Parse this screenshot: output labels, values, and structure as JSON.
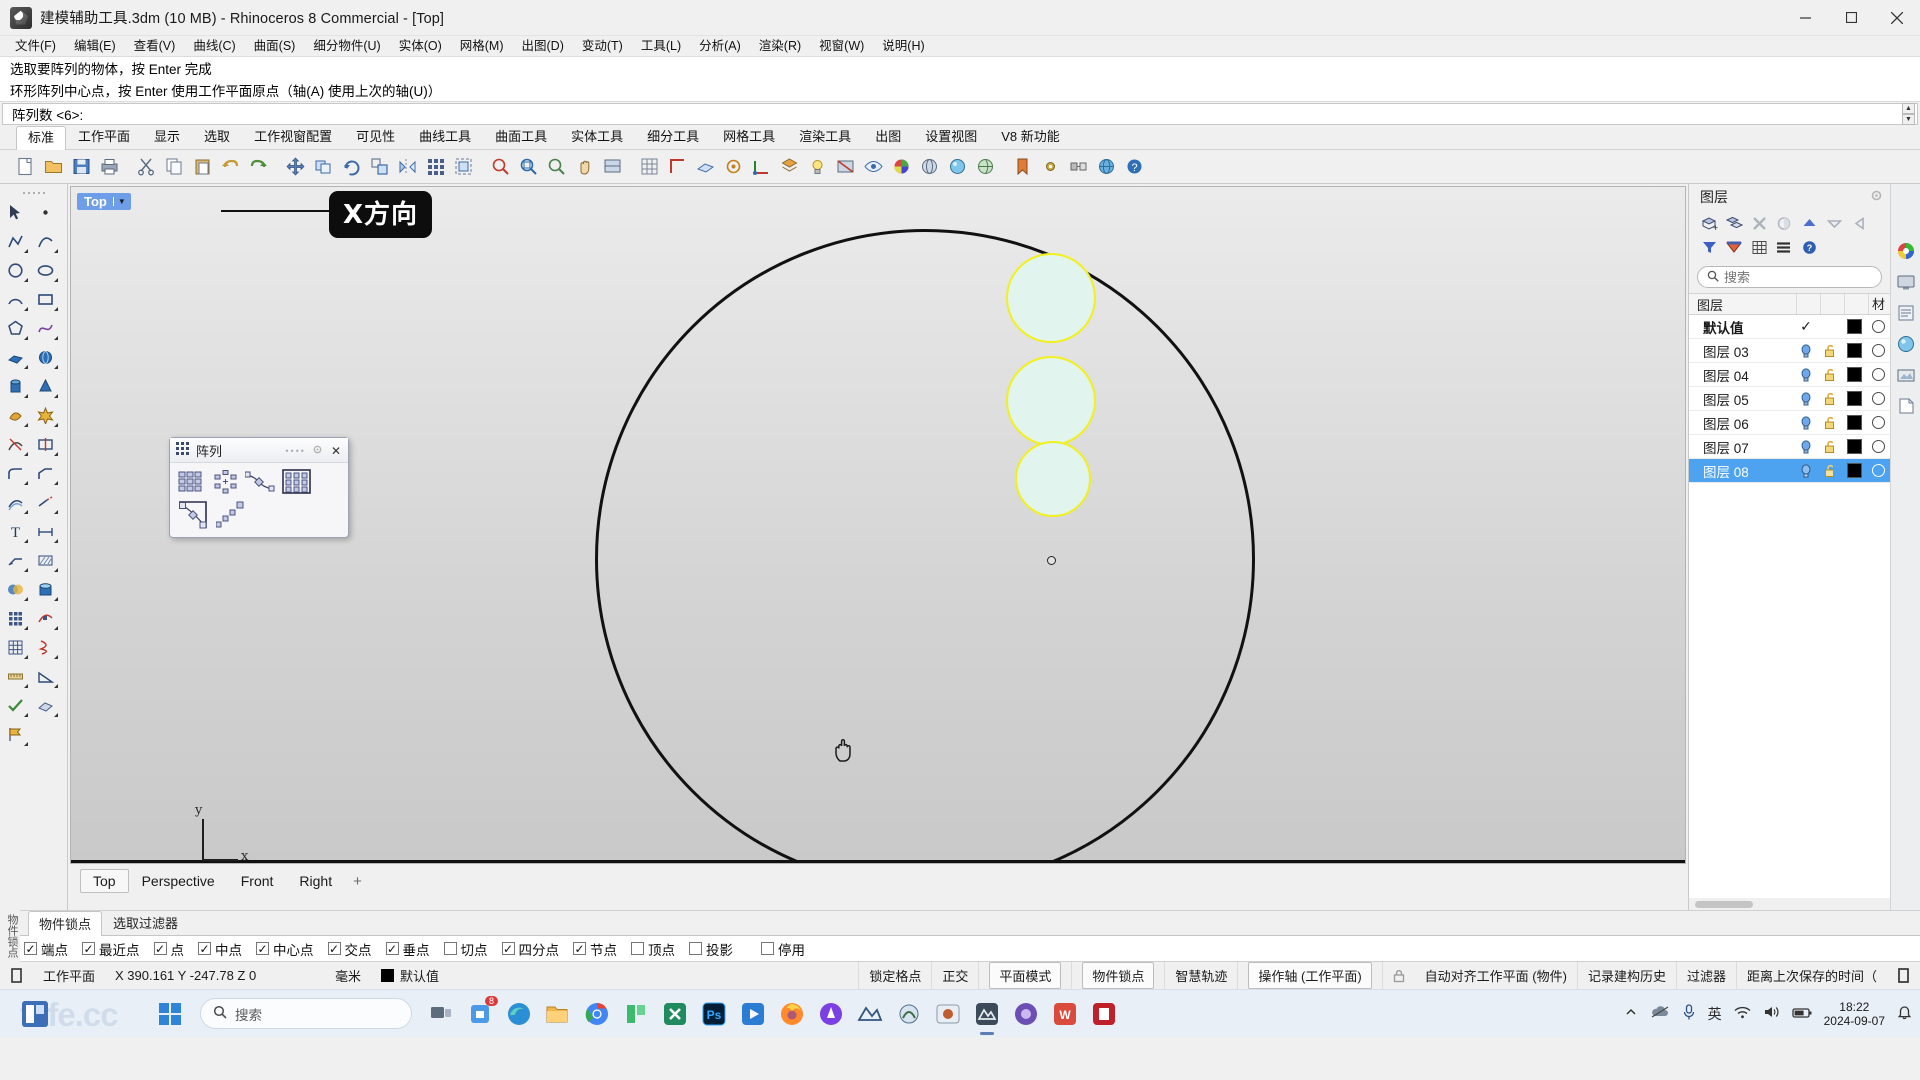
{
  "window": {
    "title": "建模辅助工具.3dm (10 MB) - Rhinoceros 8 Commercial - [Top]",
    "minimize": "—",
    "maximize": "□",
    "close": "✕"
  },
  "menubar": {
    "items": [
      {
        "label": "文件(F)"
      },
      {
        "label": "编辑(E)"
      },
      {
        "label": "查看(V)"
      },
      {
        "label": "曲线(C)"
      },
      {
        "label": "曲面(S)"
      },
      {
        "label": "细分物件(U)"
      },
      {
        "label": "实体(O)"
      },
      {
        "label": "网格(M)"
      },
      {
        "label": "出图(D)"
      },
      {
        "label": "变动(T)"
      },
      {
        "label": "工具(L)"
      },
      {
        "label": "分析(A)"
      },
      {
        "label": "渲染(R)"
      },
      {
        "label": "视窗(W)"
      },
      {
        "label": "说明(H)"
      }
    ]
  },
  "command": {
    "history": [
      "选取要阵列的物体，按 Enter 完成",
      "环形阵列中心点，按 Enter 使用工作平面原点（轴(A) 使用上次的轴(U)）"
    ],
    "prompt": "阵列数 <6>:"
  },
  "toolbar_tabs": {
    "items": [
      {
        "label": "标准",
        "active": true
      },
      {
        "label": "工作平面",
        "active": false
      },
      {
        "label": "显示",
        "active": false
      },
      {
        "label": "选取",
        "active": false
      },
      {
        "label": "工作视窗配置",
        "active": false
      },
      {
        "label": "可见性",
        "active": false
      },
      {
        "label": "曲线工具",
        "active": false
      },
      {
        "label": "曲面工具",
        "active": false
      },
      {
        "label": "实体工具",
        "active": false
      },
      {
        "label": "细分工具",
        "active": false
      },
      {
        "label": "网格工具",
        "active": false
      },
      {
        "label": "渲染工具",
        "active": false
      },
      {
        "label": "出图",
        "active": false
      },
      {
        "label": "设置视图",
        "active": false
      },
      {
        "label": "V8 新功能",
        "active": false
      }
    ]
  },
  "icon_toolbar": {
    "buttons": [
      {
        "name": "new-file-icon"
      },
      {
        "name": "open-file-icon"
      },
      {
        "name": "save-icon"
      },
      {
        "name": "print-icon"
      },
      {
        "name": "cut-icon"
      },
      {
        "name": "copy-icon"
      },
      {
        "name": "paste-icon"
      },
      {
        "name": "undo-icon"
      },
      {
        "name": "redo-icon"
      },
      {
        "name": "move-icon"
      },
      {
        "name": "copy-object-icon"
      },
      {
        "name": "rotate-icon"
      },
      {
        "name": "scale-icon"
      },
      {
        "name": "mirror-icon"
      },
      {
        "name": "array-icon"
      },
      {
        "name": "group-icon"
      },
      {
        "name": "zoom-extents-icon"
      },
      {
        "name": "zoom-window-icon"
      },
      {
        "name": "zoom-selected-icon"
      },
      {
        "name": "pan-icon"
      },
      {
        "name": "shade-icon"
      },
      {
        "name": "grid-snap-icon"
      },
      {
        "name": "ortho-icon"
      },
      {
        "name": "planar-icon"
      },
      {
        "name": "osnap-icon"
      },
      {
        "name": "gumball-icon"
      },
      {
        "name": "layer-icon"
      },
      {
        "name": "light-icon"
      },
      {
        "name": "hide-icon"
      },
      {
        "name": "show-icon"
      },
      {
        "name": "color-wheel-icon"
      },
      {
        "name": "render-icon"
      },
      {
        "name": "material-icon"
      },
      {
        "name": "environment-icon"
      },
      {
        "name": "sun-icon"
      },
      {
        "name": "bookmark-icon"
      },
      {
        "name": "settings-icon"
      },
      {
        "name": "analysis-icon"
      },
      {
        "name": "globe-icon"
      },
      {
        "name": "help-icon"
      }
    ]
  },
  "left_toolbar": {
    "buttons": [
      {
        "name": "select-arrow-icon"
      },
      {
        "name": "point-icon"
      },
      {
        "name": "polyline-icon"
      },
      {
        "name": "curve-icon"
      },
      {
        "name": "circle-icon"
      },
      {
        "name": "ellipse-icon"
      },
      {
        "name": "arc-icon"
      },
      {
        "name": "rectangle-icon"
      },
      {
        "name": "polygon-icon"
      },
      {
        "name": "freeform-icon"
      },
      {
        "name": "surface-icon"
      },
      {
        "name": "sphere-icon"
      },
      {
        "name": "cylinder-icon"
      },
      {
        "name": "cone-icon"
      },
      {
        "name": "subd-icon"
      },
      {
        "name": "explode-icon"
      },
      {
        "name": "trim-icon"
      },
      {
        "name": "split-icon"
      },
      {
        "name": "fillet-icon"
      },
      {
        "name": "chamfer-icon"
      },
      {
        "name": "offset-icon"
      },
      {
        "name": "extend-icon"
      },
      {
        "name": "text-icon"
      },
      {
        "name": "dimension-icon"
      },
      {
        "name": "leader-icon"
      },
      {
        "name": "hatch-icon"
      },
      {
        "name": "boolean-icon"
      },
      {
        "name": "cap-icon"
      },
      {
        "name": "array-tool-icon"
      },
      {
        "name": "flow-icon"
      },
      {
        "name": "grid-array-icon"
      },
      {
        "name": "twist-icon"
      },
      {
        "name": "measure-icon"
      },
      {
        "name": "angle-icon"
      },
      {
        "name": "check-icon"
      },
      {
        "name": "shell-icon"
      },
      {
        "name": "flag-icon"
      }
    ]
  },
  "viewport": {
    "label": "Top",
    "tooltip": "X方向",
    "axis_y": "y",
    "axis_x": "x",
    "cursor": "hand-pan-cursor",
    "tabs": [
      {
        "label": "Top",
        "active": true
      },
      {
        "label": "Perspective",
        "active": false
      },
      {
        "label": "Front",
        "active": false
      },
      {
        "label": "Right",
        "active": false
      }
    ],
    "add_tab": "+"
  },
  "array_panel": {
    "title": "阵列",
    "close": "✕",
    "buttons": [
      {
        "name": "rectangular-array-icon"
      },
      {
        "name": "polar-array-icon"
      },
      {
        "name": "array-along-curve-icon"
      },
      {
        "name": "array-linear-icon"
      },
      {
        "name": "array-along-surface-icon"
      },
      {
        "name": "array-along-curve-on-surface-icon"
      }
    ]
  },
  "layers": {
    "title": "图层",
    "search_placeholder": "搜索",
    "columns": {
      "name": "图层",
      "material": "材"
    },
    "tool_buttons": [
      {
        "name": "new-layer-icon"
      },
      {
        "name": "new-sublayer-icon"
      },
      {
        "name": "delete-layer-icon"
      },
      {
        "name": "duplicate-layer-icon"
      },
      {
        "name": "move-up-icon"
      },
      {
        "name": "move-down-icon"
      },
      {
        "name": "move-left-icon"
      },
      {
        "name": "filter-icon"
      },
      {
        "name": "layer-color-icon"
      },
      {
        "name": "table-view-icon"
      },
      {
        "name": "list-view-icon"
      },
      {
        "name": "help-icon"
      }
    ],
    "rows": [
      {
        "name": "默认值",
        "current": true,
        "visible": null,
        "locked": null,
        "color": "#000000",
        "selected": false
      },
      {
        "name": "图层 03",
        "current": false,
        "visible": true,
        "locked": false,
        "color": "#000000",
        "selected": false
      },
      {
        "name": "图层 04",
        "current": false,
        "visible": true,
        "locked": false,
        "color": "#000000",
        "selected": false
      },
      {
        "name": "图层 05",
        "current": false,
        "visible": true,
        "locked": false,
        "color": "#000000",
        "selected": false
      },
      {
        "name": "图层 06",
        "current": false,
        "visible": true,
        "locked": false,
        "color": "#000000",
        "selected": false
      },
      {
        "name": "图层 07",
        "current": false,
        "visible": true,
        "locked": false,
        "color": "#000000",
        "selected": false
      },
      {
        "name": "图层 08",
        "current": false,
        "visible": true,
        "locked": false,
        "color": "#000000",
        "selected": true
      }
    ],
    "dock_icons": [
      {
        "name": "color-wheel-icon"
      },
      {
        "name": "display-icon"
      },
      {
        "name": "properties-icon"
      },
      {
        "name": "material-icon"
      },
      {
        "name": "render-icon"
      },
      {
        "name": "notes-icon"
      }
    ]
  },
  "osnap": {
    "side_label": "物件锁点",
    "tabs": [
      {
        "label": "物件锁点",
        "active": true
      },
      {
        "label": "选取过滤器",
        "active": false
      }
    ],
    "options": [
      {
        "label": "端点",
        "checked": true
      },
      {
        "label": "最近点",
        "checked": true
      },
      {
        "label": "点",
        "checked": true
      },
      {
        "label": "中点",
        "checked": true
      },
      {
        "label": "中心点",
        "checked": true
      },
      {
        "label": "交点",
        "checked": true
      },
      {
        "label": "垂点",
        "checked": true
      },
      {
        "label": "切点",
        "checked": false
      },
      {
        "label": "四分点",
        "checked": true
      },
      {
        "label": "节点",
        "checked": true
      },
      {
        "label": "顶点",
        "checked": false
      },
      {
        "label": "投影",
        "checked": false
      },
      {
        "label": "停用",
        "checked": false
      }
    ]
  },
  "statusbar": {
    "cplane_label": "工作平面",
    "coords": "X 390.161 Y -247.78 Z 0",
    "units": "毫米",
    "layer_color": "#000000",
    "layer_name": "默认值",
    "toggles": [
      {
        "label": "锁定格点",
        "active": false
      },
      {
        "label": "正交",
        "active": false
      },
      {
        "label": "平面模式",
        "active": true
      },
      {
        "label": "物件锁点",
        "active": true
      },
      {
        "label": "智慧轨迹",
        "active": false
      },
      {
        "label": "操作轴 (工作平面)",
        "active": true
      }
    ],
    "lock_icon": "lock-icon",
    "auto_cplane": "自动对齐工作平面 (物件)",
    "history": "记录建构历史",
    "filter": "过滤器",
    "save_time": "距离上次保存的时间（"
  },
  "taskbar": {
    "watermark": "tafe.cc",
    "search_placeholder": "搜索",
    "start_icon": "windows-start-icon",
    "apps": [
      {
        "name": "taskview-icon"
      },
      {
        "name": "store-icon",
        "badge": "8"
      },
      {
        "name": "edge-icon"
      },
      {
        "name": "file-explorer-icon"
      },
      {
        "name": "chrome-icon"
      },
      {
        "name": "app-green-icon"
      },
      {
        "name": "app-x-icon"
      },
      {
        "name": "photoshop-icon"
      },
      {
        "name": "media-player-icon"
      },
      {
        "name": "firefox-icon"
      },
      {
        "name": "ai-icon"
      },
      {
        "name": "rhino-icon"
      },
      {
        "name": "grasshopper-icon"
      },
      {
        "name": "keyshot-icon"
      },
      {
        "name": "rhino-active-icon",
        "running": true
      },
      {
        "name": "app-purple-icon"
      },
      {
        "name": "wps-icon"
      },
      {
        "name": "red-app-icon"
      }
    ],
    "tray": {
      "chevron": "chevron-up-icon",
      "onedrive": "onedrive-icon",
      "mic": "microphone-icon",
      "ime": "英",
      "wifi": "wifi-icon",
      "volume": "volume-icon",
      "battery": "battery-icon",
      "time": "18:22",
      "date": "2024-09-07",
      "notify": "bell-icon"
    }
  }
}
